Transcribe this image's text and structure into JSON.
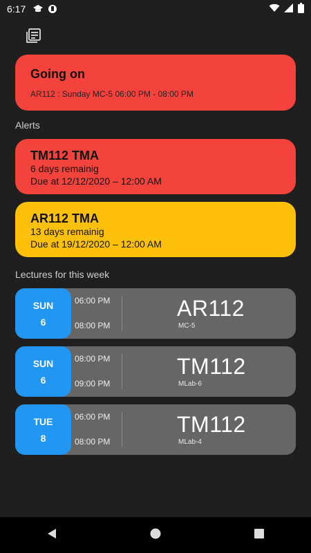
{
  "status_bar": {
    "time": "6:17"
  },
  "going_on": {
    "title": "Going on",
    "details": "AR112 : Sunday MC-5 06:00 PM - 08:00 PM",
    "color": "#f4433c"
  },
  "alerts_section": {
    "label": "Alerts"
  },
  "alerts": [
    {
      "title": "TM112 TMA",
      "remaining": "6 days remainig",
      "due": "Due at 12/12/2020 – 12:00 AM",
      "color": "#f4433c"
    },
    {
      "title": "AR112 TMA",
      "remaining": "13 days remainig",
      "due": "Due at 19/12/2020 – 12:00 AM",
      "color": "#fec008"
    }
  ],
  "lectures_section": {
    "label": "Lectures for this week"
  },
  "lectures": [
    {
      "day": "SUN",
      "date": "6",
      "start": "06:00 PM",
      "end": "08:00 PM",
      "code": "AR112",
      "room": "MC-5"
    },
    {
      "day": "SUN",
      "date": "6",
      "start": "08:00 PM",
      "end": "09:00 PM",
      "code": "TM112",
      "room": "MLab-6"
    },
    {
      "day": "TUE",
      "date": "8",
      "start": "06:00 PM",
      "end": "08:00 PM",
      "code": "TM112",
      "room": "MLab-4"
    }
  ],
  "colors": {
    "accent_day": "#2196f3",
    "lecture_bg": "#666666",
    "background": "#1f1f1f"
  }
}
